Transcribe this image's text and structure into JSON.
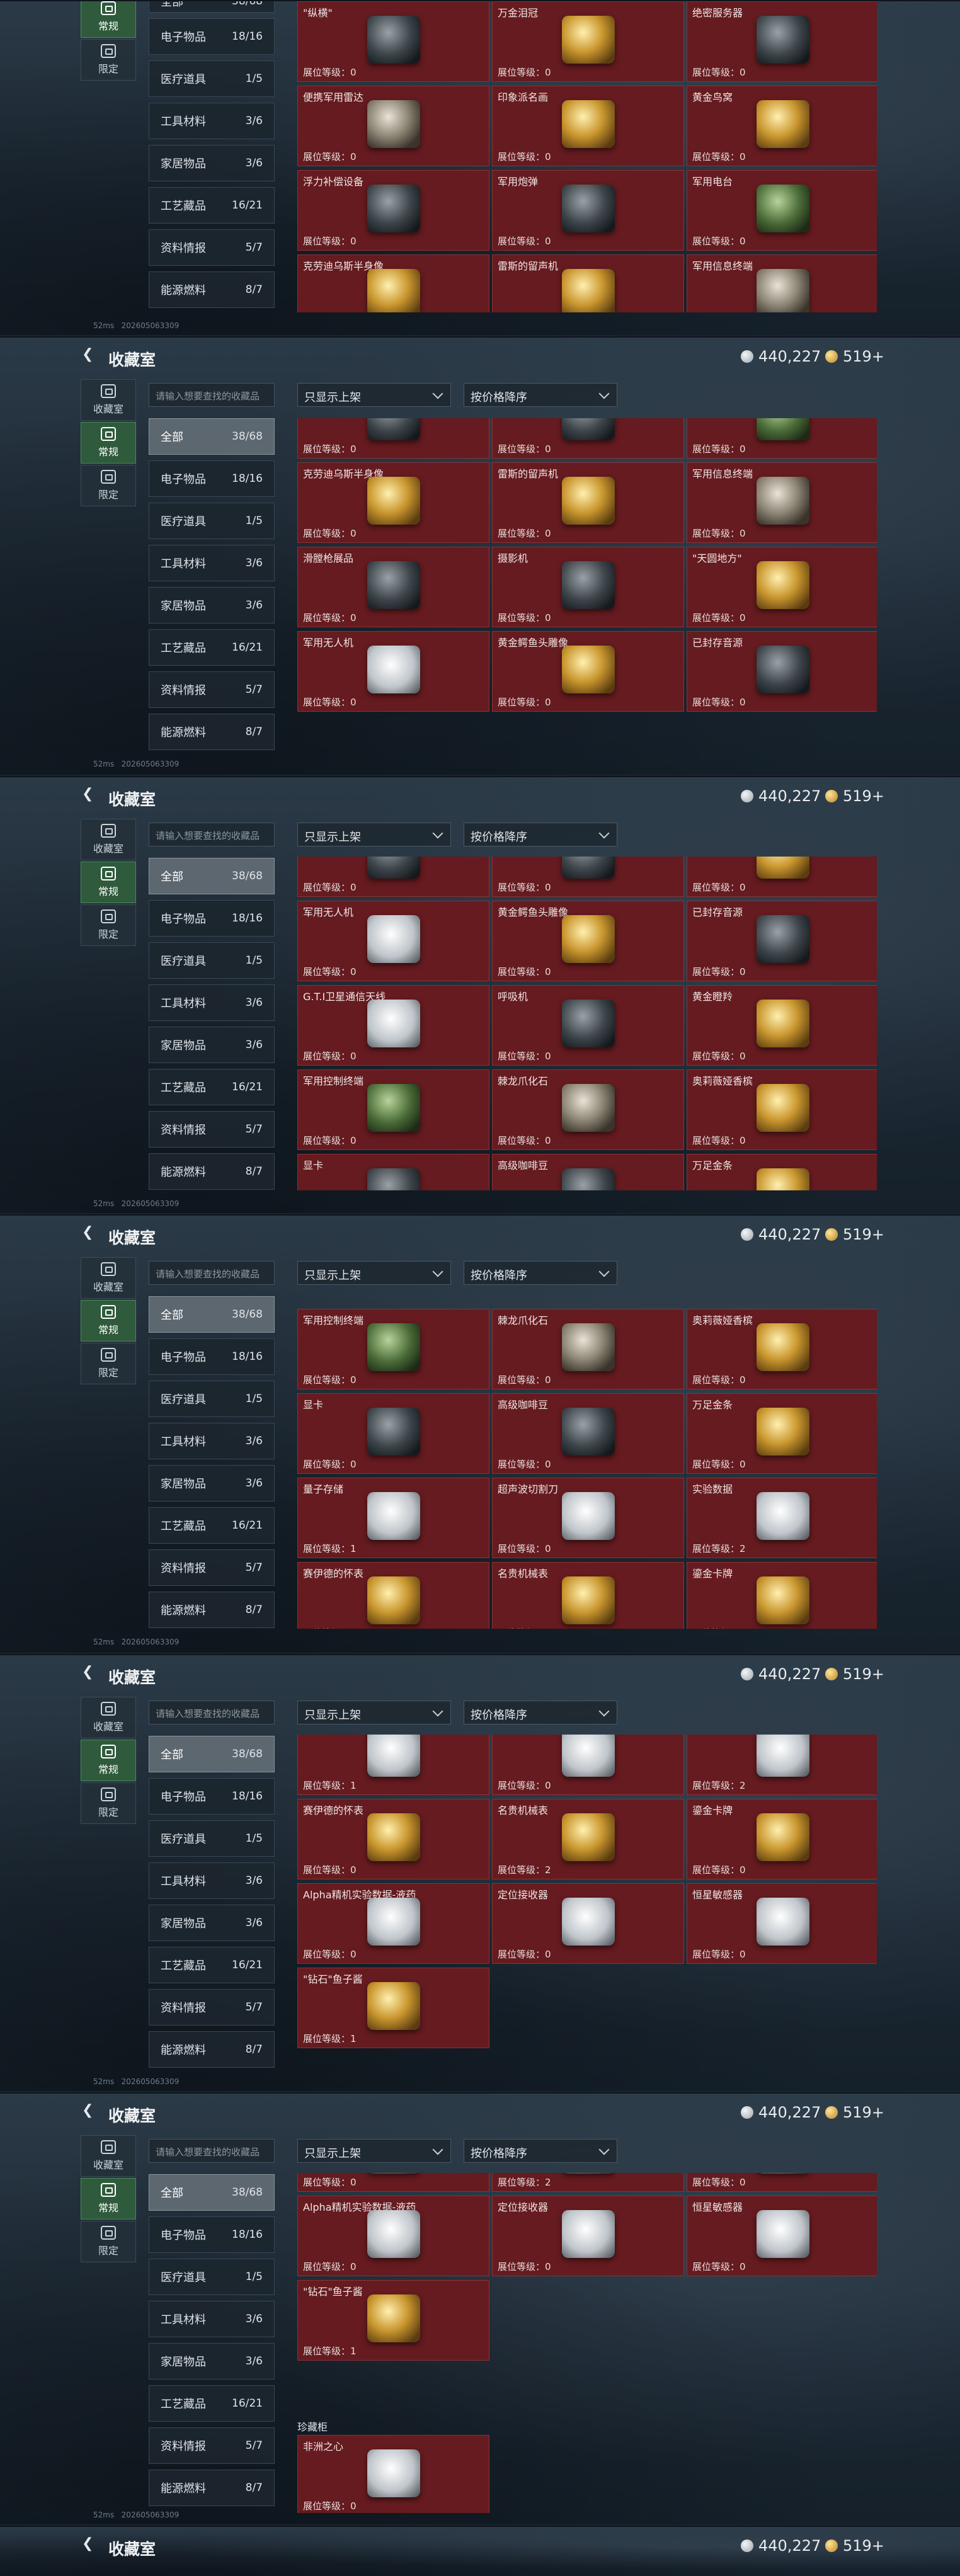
{
  "header": {
    "title": "收藏室",
    "silver": "440,227",
    "gold": "519+"
  },
  "side_tabs": [
    "收藏室",
    "常规",
    "限定"
  ],
  "search_placeholder": "请输入想要查找的收藏品",
  "filters": [
    "只显示上架",
    "按价格降序"
  ],
  "categories": [
    {
      "label": "全部",
      "count": "38/68"
    },
    {
      "label": "电子物品",
      "count": "18/16"
    },
    {
      "label": "医疗道具",
      "count": "1/5"
    },
    {
      "label": "工具材料",
      "count": "3/6"
    },
    {
      "label": "家居物品",
      "count": "3/6"
    },
    {
      "label": "工艺藏品",
      "count": "16/21"
    },
    {
      "label": "资料情报",
      "count": "5/7"
    },
    {
      "label": "能源燃料",
      "count": "8/7"
    }
  ],
  "status_text": "52ms",
  "build_id": "202605063309",
  "section_label": "珍藏柜",
  "items": {
    "banjo": {
      "name": "\"纵横\"",
      "level": "展位等级：0"
    },
    "crown": {
      "name": "万金泪冠",
      "level": "展位等级：0"
    },
    "server": {
      "name": "绝密服务器",
      "level": "展位等级：0"
    },
    "radar": {
      "name": "便携军用雷达",
      "level": "展位等级：0"
    },
    "painting": {
      "name": "印象派名画",
      "level": "展位等级：0"
    },
    "nest": {
      "name": "黄金鸟窝",
      "level": "展位等级：0"
    },
    "pump": {
      "name": "浮力补偿设备",
      "level": "展位等级：0"
    },
    "shell": {
      "name": "军用炮弹",
      "level": "展位等级：0"
    },
    "radio": {
      "name": "军用电台",
      "level": "展位等级：0"
    },
    "bust": {
      "name": "克劳迪乌斯半身像",
      "level": "展位等级：0"
    },
    "phono": {
      "name": "雷斯的留声机",
      "level": "展位等级：0"
    },
    "term": {
      "name": "军用信息终端",
      "level": "展位等级：0"
    },
    "rifle": {
      "name": "滑膛枪展品",
      "level": "展位等级：0"
    },
    "camera": {
      "name": "摄影机",
      "level": "展位等级：0"
    },
    "globe": {
      "name": "\"天圆地方\"",
      "level": "展位等级：0"
    },
    "drone": {
      "name": "军用无人机",
      "level": "展位等级：0"
    },
    "croc": {
      "name": "黄金鳄鱼头雕像",
      "level": "展位等级：0"
    },
    "reel": {
      "name": "已封存音源",
      "level": "展位等级：0"
    },
    "sat": {
      "name": "G.T.I卫星通信天线",
      "level": "展位等级：0"
    },
    "pager": {
      "name": "呼吸机",
      "level": "展位等级：0"
    },
    "lamp": {
      "name": "黄金瞪羚",
      "level": "展位等级：0"
    },
    "tablet": {
      "name": "军用控制终端",
      "level": "展位等级：0"
    },
    "claw": {
      "name": "棘龙爪化石",
      "level": "展位等级：0"
    },
    "bottle": {
      "name": "奥莉薇娅香槟",
      "level": "展位等级：0"
    },
    "gpu": {
      "name": "显卡",
      "level": "展位等级：0"
    },
    "coffee": {
      "name": "高级咖啡豆",
      "level": "展位等级：0"
    },
    "gold": {
      "name": "万足金条",
      "level": "展位等级：0"
    },
    "drive": {
      "name": "量子存储",
      "level": "展位等级：1"
    },
    "knife": {
      "name": "超声波切割刀",
      "level": "展位等级：0"
    },
    "disc": {
      "name": "实验数据",
      "level": "展位等级：2"
    },
    "watch": {
      "name": "赛伊德的怀表",
      "level": "展位等级：0"
    },
    "rwatch": {
      "name": "名贵机械表",
      "level": "展位等级：2"
    },
    "card": {
      "name": "鎏金卡牌",
      "level": "展位等级：0"
    },
    "alpha": {
      "name": "Alpha精机实验数据-液药",
      "level": "展位等级：0"
    },
    "locator": {
      "name": "定位接收器",
      "level": "展位等级：0"
    },
    "sensor": {
      "name": "恒星敏感器",
      "level": "展位等级：0"
    },
    "box": {
      "name": "\"钻石\"鱼子酱",
      "level": "展位等级：1"
    },
    "heart": {
      "name": "非洲之心",
      "level": "展位等级：0"
    }
  }
}
